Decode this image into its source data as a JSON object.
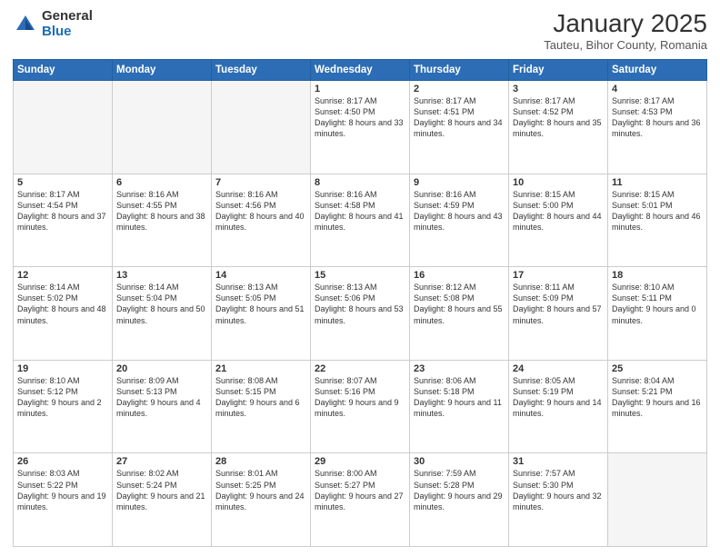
{
  "logo": {
    "general": "General",
    "blue": "Blue"
  },
  "title": "January 2025",
  "subtitle": "Tauteu, Bihor County, Romania",
  "weekdays": [
    "Sunday",
    "Monday",
    "Tuesday",
    "Wednesday",
    "Thursday",
    "Friday",
    "Saturday"
  ],
  "weeks": [
    [
      {
        "day": "",
        "info": ""
      },
      {
        "day": "",
        "info": ""
      },
      {
        "day": "",
        "info": ""
      },
      {
        "day": "1",
        "info": "Sunrise: 8:17 AM\nSunset: 4:50 PM\nDaylight: 8 hours\nand 33 minutes."
      },
      {
        "day": "2",
        "info": "Sunrise: 8:17 AM\nSunset: 4:51 PM\nDaylight: 8 hours\nand 34 minutes."
      },
      {
        "day": "3",
        "info": "Sunrise: 8:17 AM\nSunset: 4:52 PM\nDaylight: 8 hours\nand 35 minutes."
      },
      {
        "day": "4",
        "info": "Sunrise: 8:17 AM\nSunset: 4:53 PM\nDaylight: 8 hours\nand 36 minutes."
      }
    ],
    [
      {
        "day": "5",
        "info": "Sunrise: 8:17 AM\nSunset: 4:54 PM\nDaylight: 8 hours\nand 37 minutes."
      },
      {
        "day": "6",
        "info": "Sunrise: 8:16 AM\nSunset: 4:55 PM\nDaylight: 8 hours\nand 38 minutes."
      },
      {
        "day": "7",
        "info": "Sunrise: 8:16 AM\nSunset: 4:56 PM\nDaylight: 8 hours\nand 40 minutes."
      },
      {
        "day": "8",
        "info": "Sunrise: 8:16 AM\nSunset: 4:58 PM\nDaylight: 8 hours\nand 41 minutes."
      },
      {
        "day": "9",
        "info": "Sunrise: 8:16 AM\nSunset: 4:59 PM\nDaylight: 8 hours\nand 43 minutes."
      },
      {
        "day": "10",
        "info": "Sunrise: 8:15 AM\nSunset: 5:00 PM\nDaylight: 8 hours\nand 44 minutes."
      },
      {
        "day": "11",
        "info": "Sunrise: 8:15 AM\nSunset: 5:01 PM\nDaylight: 8 hours\nand 46 minutes."
      }
    ],
    [
      {
        "day": "12",
        "info": "Sunrise: 8:14 AM\nSunset: 5:02 PM\nDaylight: 8 hours\nand 48 minutes."
      },
      {
        "day": "13",
        "info": "Sunrise: 8:14 AM\nSunset: 5:04 PM\nDaylight: 8 hours\nand 50 minutes."
      },
      {
        "day": "14",
        "info": "Sunrise: 8:13 AM\nSunset: 5:05 PM\nDaylight: 8 hours\nand 51 minutes."
      },
      {
        "day": "15",
        "info": "Sunrise: 8:13 AM\nSunset: 5:06 PM\nDaylight: 8 hours\nand 53 minutes."
      },
      {
        "day": "16",
        "info": "Sunrise: 8:12 AM\nSunset: 5:08 PM\nDaylight: 8 hours\nand 55 minutes."
      },
      {
        "day": "17",
        "info": "Sunrise: 8:11 AM\nSunset: 5:09 PM\nDaylight: 8 hours\nand 57 minutes."
      },
      {
        "day": "18",
        "info": "Sunrise: 8:10 AM\nSunset: 5:11 PM\nDaylight: 9 hours\nand 0 minutes."
      }
    ],
    [
      {
        "day": "19",
        "info": "Sunrise: 8:10 AM\nSunset: 5:12 PM\nDaylight: 9 hours\nand 2 minutes."
      },
      {
        "day": "20",
        "info": "Sunrise: 8:09 AM\nSunset: 5:13 PM\nDaylight: 9 hours\nand 4 minutes."
      },
      {
        "day": "21",
        "info": "Sunrise: 8:08 AM\nSunset: 5:15 PM\nDaylight: 9 hours\nand 6 minutes."
      },
      {
        "day": "22",
        "info": "Sunrise: 8:07 AM\nSunset: 5:16 PM\nDaylight: 9 hours\nand 9 minutes."
      },
      {
        "day": "23",
        "info": "Sunrise: 8:06 AM\nSunset: 5:18 PM\nDaylight: 9 hours\nand 11 minutes."
      },
      {
        "day": "24",
        "info": "Sunrise: 8:05 AM\nSunset: 5:19 PM\nDaylight: 9 hours\nand 14 minutes."
      },
      {
        "day": "25",
        "info": "Sunrise: 8:04 AM\nSunset: 5:21 PM\nDaylight: 9 hours\nand 16 minutes."
      }
    ],
    [
      {
        "day": "26",
        "info": "Sunrise: 8:03 AM\nSunset: 5:22 PM\nDaylight: 9 hours\nand 19 minutes."
      },
      {
        "day": "27",
        "info": "Sunrise: 8:02 AM\nSunset: 5:24 PM\nDaylight: 9 hours\nand 21 minutes."
      },
      {
        "day": "28",
        "info": "Sunrise: 8:01 AM\nSunset: 5:25 PM\nDaylight: 9 hours\nand 24 minutes."
      },
      {
        "day": "29",
        "info": "Sunrise: 8:00 AM\nSunset: 5:27 PM\nDaylight: 9 hours\nand 27 minutes."
      },
      {
        "day": "30",
        "info": "Sunrise: 7:59 AM\nSunset: 5:28 PM\nDaylight: 9 hours\nand 29 minutes."
      },
      {
        "day": "31",
        "info": "Sunrise: 7:57 AM\nSunset: 5:30 PM\nDaylight: 9 hours\nand 32 minutes."
      },
      {
        "day": "",
        "info": ""
      }
    ]
  ]
}
